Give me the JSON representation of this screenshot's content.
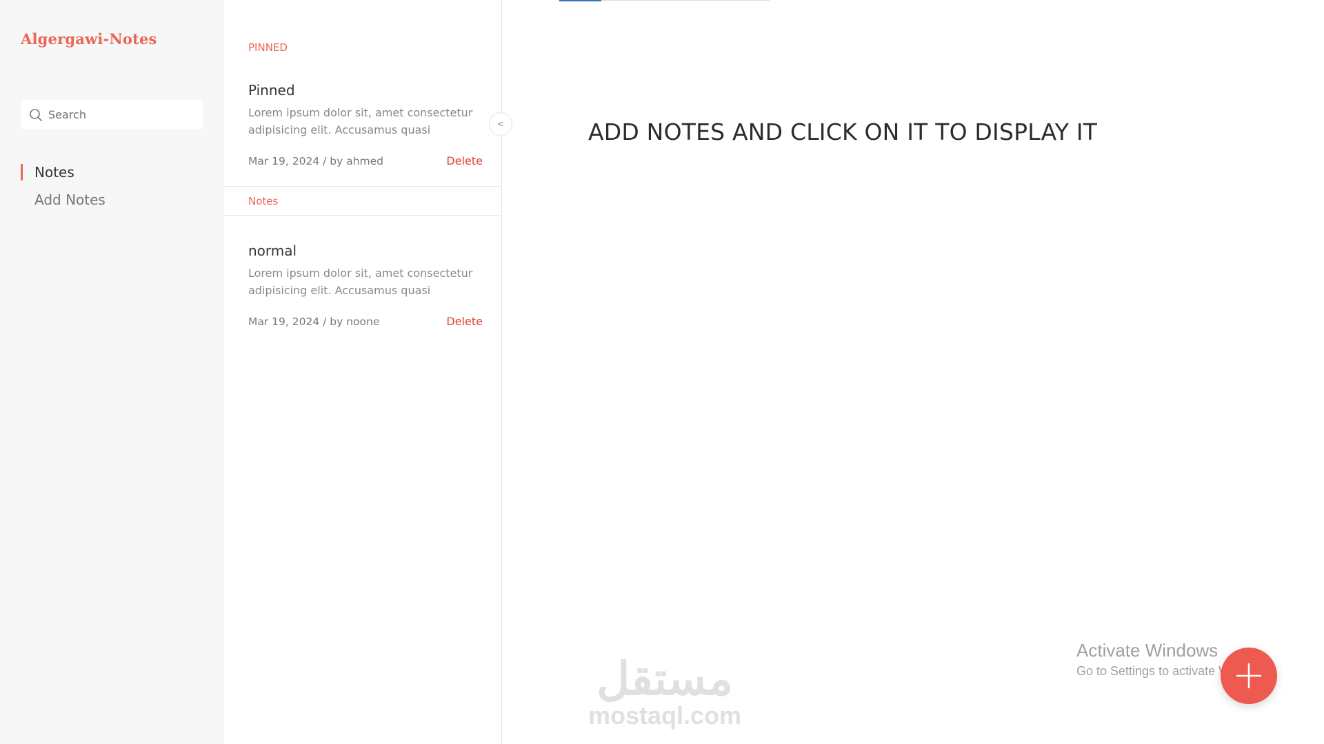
{
  "brand": {
    "title": "Algergawi-Notes"
  },
  "sidebar": {
    "search": {
      "placeholder": "Search"
    },
    "nav": [
      {
        "label": "Notes",
        "active": true
      },
      {
        "label": "Add Notes",
        "active": false
      }
    ]
  },
  "list": {
    "pinned_section": "PINNED",
    "notes_section": "Notes",
    "pinned_notes": [
      {
        "title": "Pinned",
        "body": "Lorem ipsum dolor sit, amet consectetur adipisicing elit. Accusamus quasi",
        "meta": "Mar 19, 2024 / by ahmed",
        "delete_label": "Delete"
      }
    ],
    "notes": [
      {
        "title": "normal",
        "body": "Lorem ipsum dolor sit, amet consectetur adipisicing elit. Accusamus quasi",
        "meta": "Mar 19, 2024 / by noone",
        "delete_label": "Delete"
      }
    ],
    "collapse_glyph": "<"
  },
  "main": {
    "placeholder": "ADD NOTES AND CLICK ON IT TO DISPLAY IT"
  },
  "watermark": {
    "arabic": "مستقل",
    "latin": "mostaql.com"
  },
  "os_notice": {
    "title": "Activate Windows",
    "subtitle": "Go to Settings to activate Windows."
  },
  "colors": {
    "accent": "#ec6456",
    "delete": "#e2422f",
    "fab": "#ee5a4f"
  },
  "icons": {
    "search": "search-icon",
    "fab": "plus-icon"
  }
}
